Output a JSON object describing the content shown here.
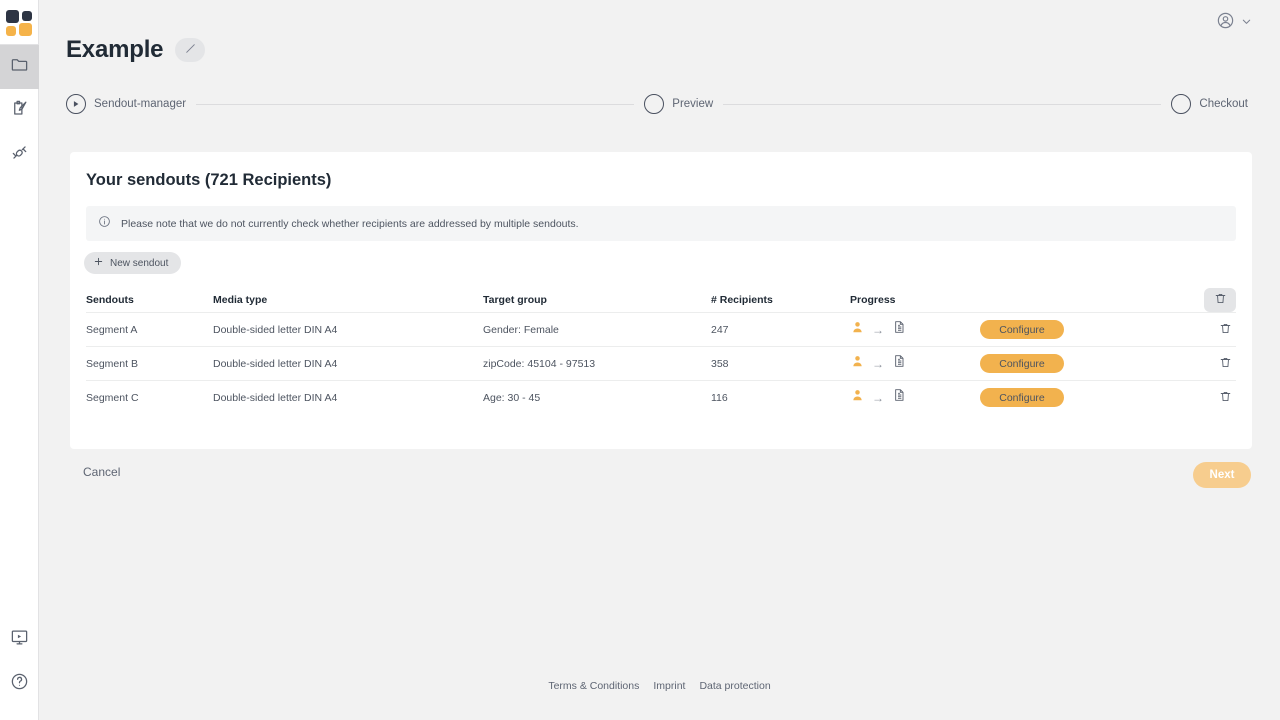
{
  "brand": {
    "logo_name": "app-logo",
    "accent": "#f2b24e",
    "dark": "#2e3544"
  },
  "sidebar": {
    "items": [
      {
        "icon": "folder-icon",
        "name": "sidebar-item-projects",
        "active": true
      },
      {
        "icon": "clipboard-pen-icon",
        "name": "sidebar-item-campaigns",
        "active": false
      },
      {
        "icon": "plug-connector-icon",
        "name": "sidebar-item-integrations",
        "active": false
      }
    ],
    "bottom_items": [
      {
        "icon": "monitor-play-icon",
        "name": "sidebar-item-tutorials"
      },
      {
        "icon": "help-circle-icon",
        "name": "sidebar-item-help"
      }
    ]
  },
  "topbar": {
    "avatar_icon": "user-circle-icon",
    "chevron_icon": "chevron-down-icon"
  },
  "header": {
    "title": "Example",
    "edit_icon": "pencil-icon"
  },
  "stepper": {
    "steps": [
      {
        "label": "Sendout-manager",
        "state": "current",
        "icon": "play-circle-icon"
      },
      {
        "label": "Preview",
        "state": "upcoming",
        "icon": "circle-icon"
      },
      {
        "label": "Checkout",
        "state": "upcoming",
        "icon": "circle-icon"
      }
    ]
  },
  "card": {
    "title": "Your sendouts (721 Recipients)",
    "notice": {
      "icon": "info-icon",
      "text": "Please note that we do not currently check whether recipients are addressed by multiple sendouts."
    },
    "new_sendout_label": "New sendout",
    "new_sendout_icon": "plus-icon",
    "delete_all_icon": "trash-icon"
  },
  "table": {
    "columns": [
      "Sendouts",
      "Media type",
      "Target group",
      "# Recipients",
      "Progress"
    ],
    "rows": [
      {
        "sendout": "Segment A",
        "media_type": "Double-sided letter DIN A4",
        "target_group": "Gender: Female",
        "recipients": "247",
        "progress_from_icon": "person-icon",
        "progress_arrow": "→",
        "progress_to_icon": "documents-icon",
        "action_label": "Configure",
        "delete_icon": "trash-icon"
      },
      {
        "sendout": "Segment B",
        "media_type": "Double-sided letter DIN A4",
        "target_group": "zipCode: 45104 - 97513",
        "recipients": "358",
        "progress_from_icon": "person-icon",
        "progress_arrow": "→",
        "progress_to_icon": "documents-icon",
        "action_label": "Configure",
        "delete_icon": "trash-icon"
      },
      {
        "sendout": "Segment C",
        "media_type": "Double-sided letter DIN A4",
        "target_group": "Age: 30 - 45",
        "recipients": "116",
        "progress_from_icon": "person-icon",
        "progress_arrow": "→",
        "progress_to_icon": "documents-icon",
        "action_label": "Configure",
        "delete_icon": "trash-icon"
      }
    ]
  },
  "actions": {
    "cancel_label": "Cancel",
    "next_label": "Next"
  },
  "footer": {
    "links": [
      "Terms & Conditions",
      "Imprint",
      "Data protection"
    ]
  }
}
